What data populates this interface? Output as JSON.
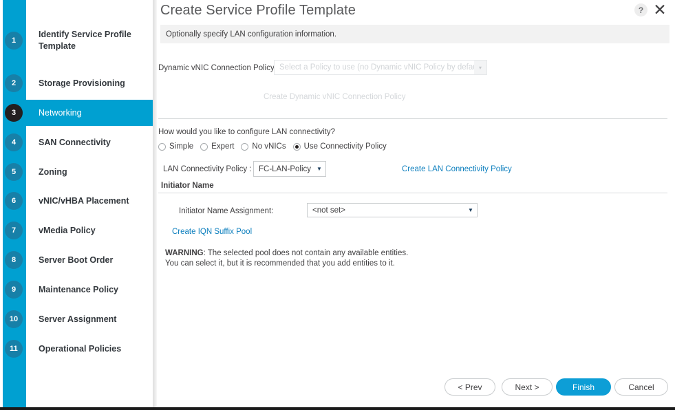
{
  "window": {
    "title": "Create Service Profile Template",
    "help_icon": "help-icon",
    "close_icon": "close-icon",
    "subtitle": "Optionally specify LAN configuration information."
  },
  "wizard": {
    "active_step": 3,
    "steps": [
      {
        "num": "1",
        "label": "Identify Service Profile Template"
      },
      {
        "num": "2",
        "label": "Storage Provisioning"
      },
      {
        "num": "3",
        "label": "Networking"
      },
      {
        "num": "4",
        "label": "SAN Connectivity"
      },
      {
        "num": "5",
        "label": "Zoning"
      },
      {
        "num": "6",
        "label": "vNIC/vHBA Placement"
      },
      {
        "num": "7",
        "label": "vMedia Policy"
      },
      {
        "num": "8",
        "label": "Server Boot Order"
      },
      {
        "num": "9",
        "label": "Maintenance Policy"
      },
      {
        "num": "10",
        "label": "Server Assignment"
      },
      {
        "num": "11",
        "label": "Operational Policies"
      }
    ]
  },
  "form": {
    "dynamic_vnic": {
      "label": "Dynamic vNIC Connection Policy:",
      "value": "Select a Policy to use (no Dynamic vNIC Policy by default)",
      "caret": "▾",
      "create_link": "Create Dynamic vNIC Connection Policy"
    },
    "lan_connectivity": {
      "question": "How would you like to configure LAN connectivity?",
      "options": [
        {
          "label": "Simple",
          "selected": false
        },
        {
          "label": "Expert",
          "selected": false
        },
        {
          "label": "No vNICs",
          "selected": false
        },
        {
          "label": "Use Connectivity Policy",
          "selected": true
        }
      ],
      "policy_label": "LAN Connectivity Policy :",
      "policy_value": "FC-LAN-Policy",
      "policy_caret": "▼",
      "create_link": "Create LAN Connectivity Policy"
    },
    "initiator": {
      "section_title": "Initiator Name",
      "assignment_label": "Initiator Name Assignment:",
      "assignment_value": "<not set>",
      "assignment_caret": "▼",
      "create_link": "Create IQN Suffix Pool",
      "warning_prefix": "WARNING",
      "warning_line1": ": The selected pool does not contain any available entities.",
      "warning_line2": "You can select it, but it is recommended that you add entities to it."
    }
  },
  "footer": {
    "prev": "< Prev",
    "next": "Next >",
    "finish": "Finish",
    "cancel": "Cancel"
  },
  "colors": {
    "accent": "#00A0D1",
    "primary_button": "#0d9ed6",
    "link": "#0d7fbe",
    "bubble": "#1780A8",
    "active_bubble": "#231f20"
  }
}
